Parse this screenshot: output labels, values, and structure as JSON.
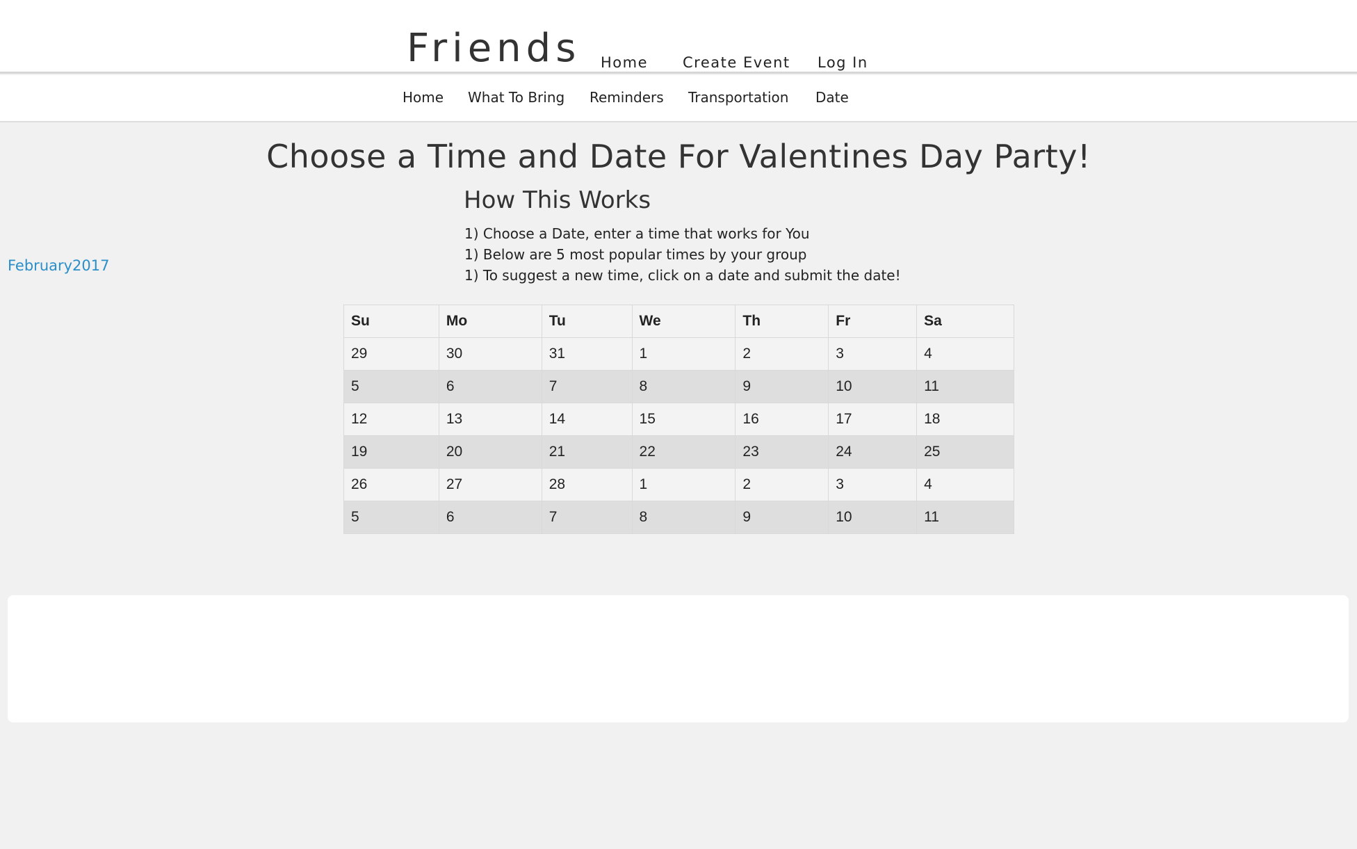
{
  "brand": "Friends",
  "top_nav": [
    "Home",
    "Create Event",
    "Log In"
  ],
  "sub_nav": [
    "Home",
    "What To Bring",
    "Reminders",
    "Transportation",
    "Date"
  ],
  "page_title": "Choose a Time and Date For Valentines Day Party!",
  "how_title": "How This Works",
  "steps": [
    "1) Choose a Date, enter a time that works for You",
    "1) Below are 5 most popular times by your group",
    "1) To suggest a new time, click on a date and submit the date!"
  ],
  "month_label": "February2017",
  "calendar": {
    "headers": [
      "Su",
      "Mo",
      "Tu",
      "We",
      "Th",
      "Fr",
      "Sa"
    ],
    "weeks": [
      [
        "29",
        "30",
        "31",
        "1",
        "2",
        "3",
        "4"
      ],
      [
        "5",
        "6",
        "7",
        "8",
        "9",
        "10",
        "11"
      ],
      [
        "12",
        "13",
        "14",
        "15",
        "16",
        "17",
        "18"
      ],
      [
        "19",
        "20",
        "21",
        "22",
        "23",
        "24",
        "25"
      ],
      [
        "26",
        "27",
        "28",
        "1",
        "2",
        "3",
        "4"
      ],
      [
        "5",
        "6",
        "7",
        "8",
        "9",
        "10",
        "11"
      ]
    ]
  },
  "colors": {
    "page_background": "#f1f1f1",
    "link": "#2a8fc9",
    "alt_row": "#dedede"
  }
}
